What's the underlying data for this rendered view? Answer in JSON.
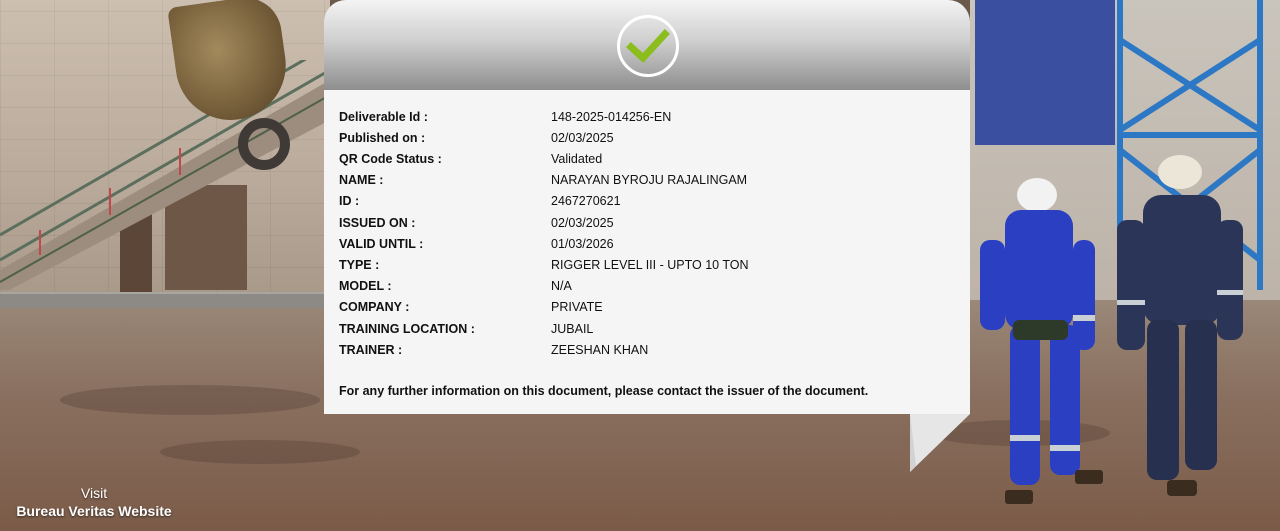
{
  "certificate": {
    "fields": [
      {
        "label": "Deliverable Id :",
        "value": "148-2025-014256-EN"
      },
      {
        "label": "Published on :",
        "value": "02/03/2025"
      },
      {
        "label": "QR Code Status :",
        "value": "Validated"
      },
      {
        "label": "NAME :",
        "value": "NARAYAN BYROJU RAJALINGAM"
      },
      {
        "label": "ID :",
        "value": "2467270621"
      },
      {
        "label": "ISSUED ON :",
        "value": "02/03/2025"
      },
      {
        "label": "VALID UNTIL :",
        "value": "01/03/2026"
      },
      {
        "label": "TYPE :",
        "value": "RIGGER LEVEL III - UPTO 10 TON"
      },
      {
        "label": "MODEL :",
        "value": "N/A"
      },
      {
        "label": "COMPANY :",
        "value": "PRIVATE"
      },
      {
        "label": "TRAINING LOCATION :",
        "value": "JUBAIL"
      },
      {
        "label": "TRAINER :",
        "value": "ZEESHAN KHAN"
      }
    ],
    "notice": "For any further information on this document, please contact the issuer of the document.",
    "status_icon": "check-icon",
    "check_color": "#8bbd1c"
  },
  "footer": {
    "visit_label": "Visit",
    "website_label": "Bureau Veritas Website"
  }
}
